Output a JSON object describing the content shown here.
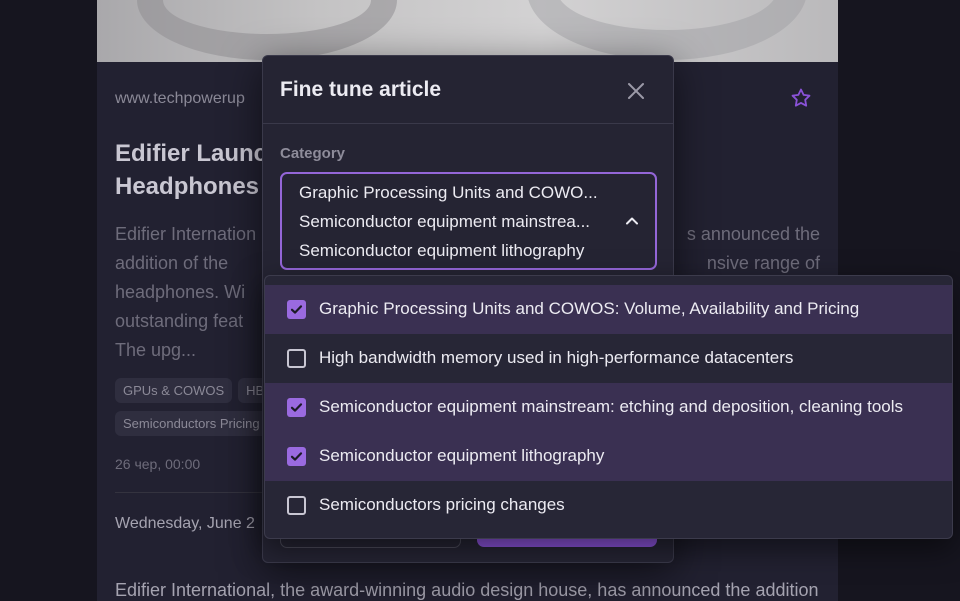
{
  "article": {
    "source": "www.techpowerup",
    "title_line1": "Edifier Launc",
    "title_line2": "Headphones",
    "excerpt_line1": "Edifier Internation",
    "excerpt_line1_end": "s announced the",
    "excerpt_line2": "addition of the",
    "excerpt_line2_end": "nsive range of",
    "excerpt_line3": "headphones. Wi",
    "excerpt_line4": "outstanding feat",
    "excerpt_line5": "The upg...",
    "tags": [
      "GPUs & COWOS",
      "HBI",
      "Semiconductors Pricing"
    ],
    "date": "26 чер, 00:00",
    "published": "Wednesday, June 2",
    "body": "Edifier International, the award-winning audio design house, has announced the addition"
  },
  "modal": {
    "title": "Fine tune article",
    "category_label": "Category",
    "selected": [
      "Graphic Processing Units and COWO...",
      "Semiconductor equipment mainstrea...",
      "Semiconductor equipment lithography"
    ]
  },
  "dropdown": {
    "options": [
      {
        "label": "Graphic Processing Units and COWOS: Volume, Availability and Pricing",
        "checked": true
      },
      {
        "label": "High bandwidth memory used in high-performance datacenters",
        "checked": false
      },
      {
        "label": "Semiconductor equipment mainstream: etching and deposition, cleaning tools",
        "checked": true
      },
      {
        "label": "Semiconductor equipment lithography",
        "checked": true
      },
      {
        "label": "Semiconductors pricing changes",
        "checked": false
      }
    ]
  },
  "colors": {
    "accent": "#9466d8",
    "checked_row": "#3a3052",
    "star": "#8a52d8"
  },
  "icons": {
    "close": "close-icon",
    "chevron": "chevron-up-icon",
    "star": "star-icon",
    "check": "check-icon"
  }
}
